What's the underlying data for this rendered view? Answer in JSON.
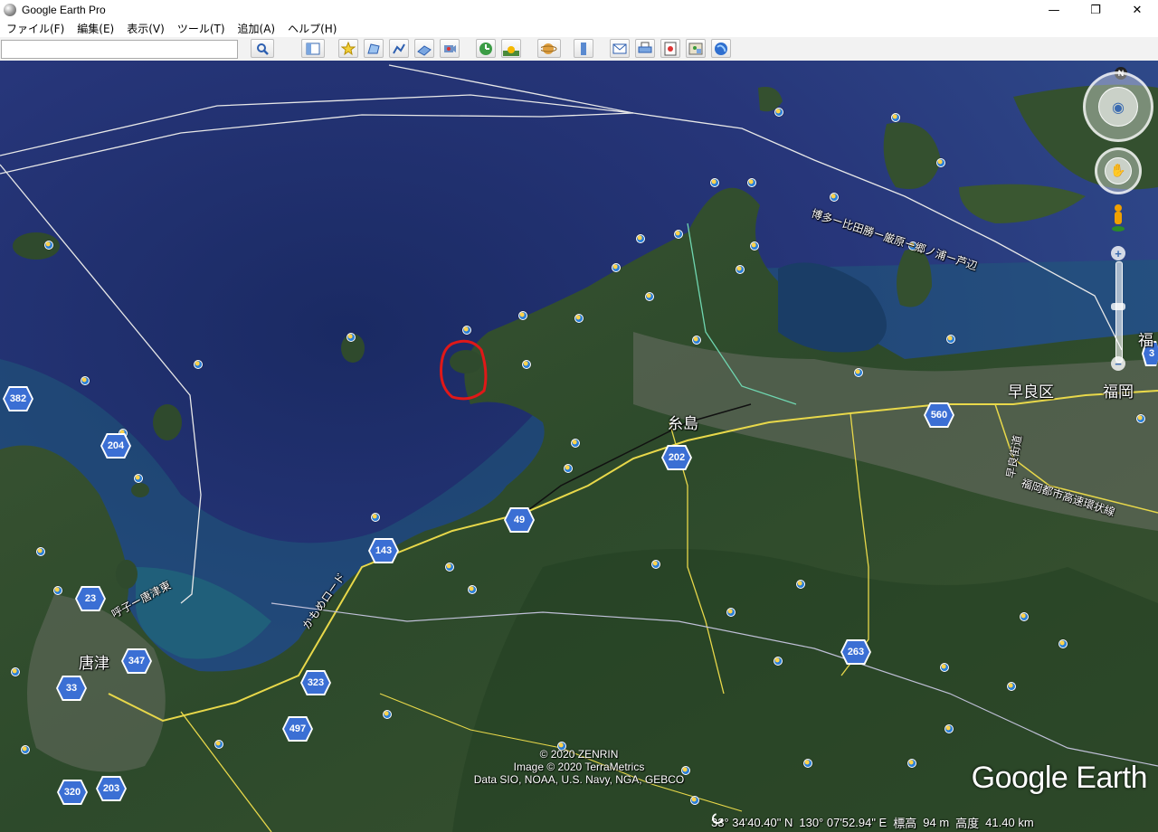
{
  "window": {
    "title": "Google Earth Pro",
    "controls": {
      "minimize": "—",
      "maximize": "❐",
      "close": "✕"
    }
  },
  "menu": [
    "ファイル(F)",
    "編集(E)",
    "表示(V)",
    "ツール(T)",
    "追加(A)",
    "ヘルプ(H)"
  ],
  "search": {
    "value": "",
    "icon": "search-icon"
  },
  "toolbar": {
    "buttons": [
      "sidebar-toggle-icon",
      "add-placemark-icon",
      "add-polygon-icon",
      "add-path-icon",
      "add-image-overlay-icon",
      "record-tour-icon",
      "historical-imagery-icon",
      "sunlight-icon",
      "switch-planet-icon",
      "ruler-icon",
      "email-icon",
      "print-icon",
      "save-image-icon",
      "view-in-google-maps-icon",
      "earth-icon"
    ]
  },
  "map": {
    "cities": [
      "糸島",
      "早良区",
      "福岡",
      "唐津",
      "福"
    ],
    "road_names": [
      "博多ー比田勝ー厳原ー郷ノ浦ー芦辺",
      "呼子ー唐津東",
      "かもめロード",
      "早良街道",
      "福岡都市高速環状線"
    ],
    "route_shields": [
      "382",
      "204",
      "23",
      "347",
      "33",
      "320",
      "203",
      "143",
      "49",
      "202",
      "560",
      "323",
      "497",
      "263",
      "3"
    ],
    "annotation": "red-circle-annotation"
  },
  "attribution": [
    "© 2020 ZENRIN",
    "Image © 2020 TerraMetrics",
    "Data SIO, NOAA, U.S. Navy, NGA, GEBCO"
  ],
  "logo": "Google Earth",
  "status": {
    "lat": "33° 34'40.40\" N",
    "lon": "130° 07'52.94\" E",
    "elevation_label": "標高",
    "elevation": "94 m",
    "altitude_label": "高度",
    "altitude": "41.40 km"
  },
  "nav": {
    "north": "N",
    "zoom_in": "+",
    "zoom_out": "−"
  }
}
